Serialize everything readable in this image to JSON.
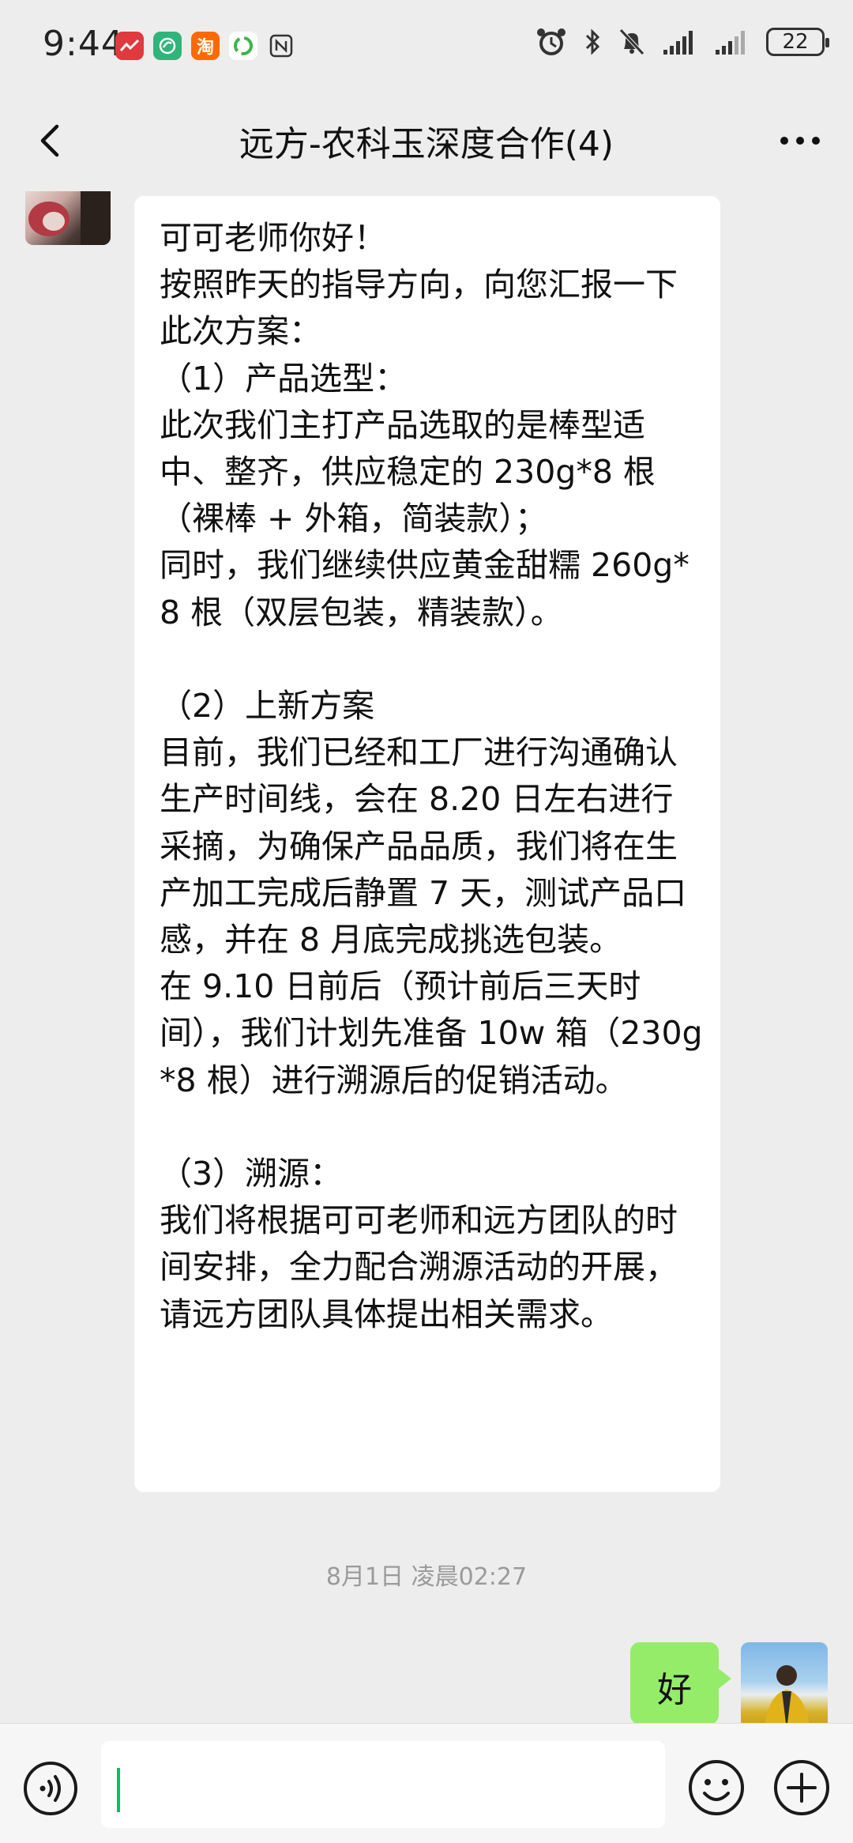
{
  "status_bar": {
    "time": "9:44",
    "battery": "22",
    "app_icons": [
      "stocks-app-icon",
      "leaf-app-icon",
      "taobao-app-icon",
      "recycle-app-icon",
      "nfc-icon"
    ],
    "taobao_glyph": "淘"
  },
  "header": {
    "title": "远方-农科玉深度合作(4)"
  },
  "messages": {
    "incoming_text": "可可老师你好！\n按照昨天的指导方向，向您汇报一下此次方案：\n（1）产品选型：\n此次我们主打产品选取的是棒型适中、整齐，供应稳定的 230g*8 根（裸棒 + 外箱，简装款）；\n同时，我们继续供应黄金甜糯 260g*8 根（双层包装，精装款）。\n\n（2）上新方案\n目前，我们已经和工厂进行沟通确认生产时间线，会在 8.20 日左右进行采摘，为确保产品品质，我们将在生产加工完成后静置 7 天，测试产品口感，并在 8 月底完成挑选包装。\n在 9.10 日前后（预计前后三天时间），我们计划先准备 10w 箱（230g*8 根）进行溯源后的促销活动。\n\n（3）溯源：\n我们将根据可可老师和远方团队的时间安排，全力配合溯源活动的开展，请远方团队具体提出相关需求。",
    "timestamp": "8月1日 凌晨02:27",
    "outgoing_text": "好"
  },
  "colors": {
    "chat_background": "#ededed",
    "outgoing_bubble": "#95ec69",
    "caret": "#07c160"
  }
}
